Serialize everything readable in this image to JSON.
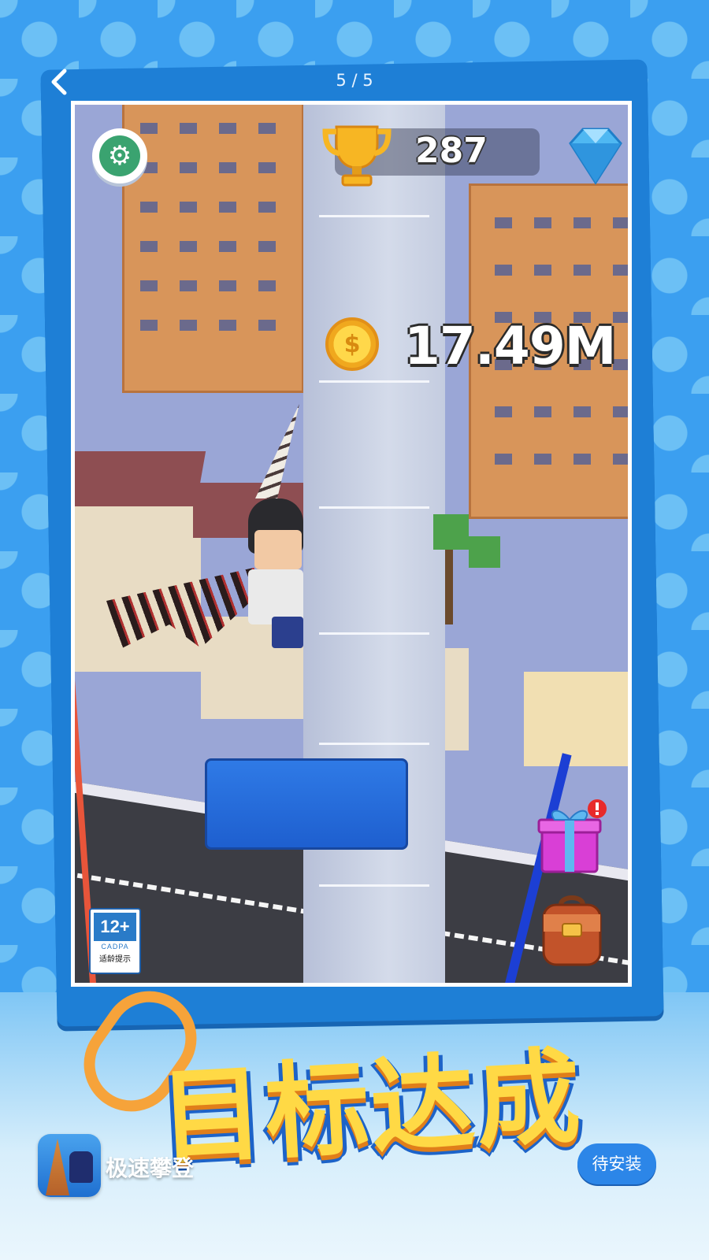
{
  "header": {
    "page_counter": "5 / 5"
  },
  "game_screen": {
    "trophy_score": "287",
    "coins": "17.49M",
    "age_rating": {
      "age": "12+",
      "org": "CADPA",
      "tip": "适龄提示"
    }
  },
  "banner": {
    "title": "目标达成"
  },
  "app": {
    "name": "极速攀登",
    "install_label": "待安装"
  },
  "colors": {
    "background": "#3b9ff0",
    "accent_yellow": "#ffd945",
    "install_button": "#2c86e8",
    "coin_gold": "#ffd84a"
  },
  "icons": [
    "back-arrow-icon",
    "settings-gear-icon",
    "trophy-icon",
    "diamond-icon",
    "coin-icon",
    "gift-icon",
    "backpack-icon",
    "paperclip-icon",
    "app-icon"
  ]
}
